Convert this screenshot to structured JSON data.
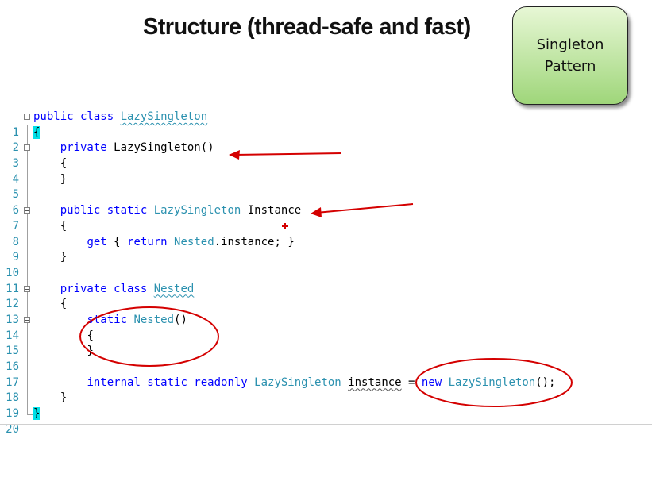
{
  "slide": {
    "title": "Structure (thread-safe and fast)",
    "badge_line1": "Singleton",
    "badge_line2": "Pattern"
  },
  "code": {
    "line_numbers": [
      "1",
      "2",
      "3",
      "4",
      "5",
      "6",
      "7",
      "8",
      "9",
      "10",
      "11",
      "12",
      "13",
      "14",
      "15",
      "16",
      "17",
      "18",
      "19",
      "20"
    ],
    "l1": {
      "kw": "public class ",
      "type": "LazySingleton"
    },
    "l2": {
      "brace": "{"
    },
    "l3": {
      "kw": "private ",
      "rest": "LazySingleton()"
    },
    "l4": {
      "text": "{"
    },
    "l5": {
      "text": "}"
    },
    "l7": {
      "kw": "public static ",
      "type": "LazySingleton",
      "rest": " Instance"
    },
    "l8": {
      "text": "{"
    },
    "l9": {
      "kw1": "get",
      "p1": " { ",
      "kw2": "return",
      "p2": " ",
      "type": "Nested",
      "p3": ".instance; }"
    },
    "l10": {
      "text": "}"
    },
    "l12": {
      "kw": "private class ",
      "type": "Nested"
    },
    "l13": {
      "text": "{"
    },
    "l14": {
      "kw": "static ",
      "type": "Nested",
      "rest": "()"
    },
    "l15": {
      "text": "{"
    },
    "l16": {
      "text": "}"
    },
    "l18": {
      "kw": "internal static readonly ",
      "type": "LazySingleton",
      "p1": " ",
      "ident": "instance",
      "p2": " = ",
      "kw2": "new ",
      "type2": "LazySingleton",
      "p3": "();"
    },
    "l19": {
      "text": "}"
    },
    "l20": {
      "brace": "}"
    }
  },
  "colors": {
    "keyword": "#0000ff",
    "type": "#2b91af",
    "line_number": "#2b91af",
    "annotation_red": "#d40000",
    "brace_highlight": "#00e0e8",
    "badge_top": "#e7f7d5",
    "badge_bottom": "#9fd67a"
  },
  "annotations": {
    "arrows": [
      "arrow pointing to private constructor",
      "arrow pointing to Instance property"
    ],
    "circles": [
      "circle around static Nested constructor",
      "circle around new LazySingleton()"
    ]
  }
}
